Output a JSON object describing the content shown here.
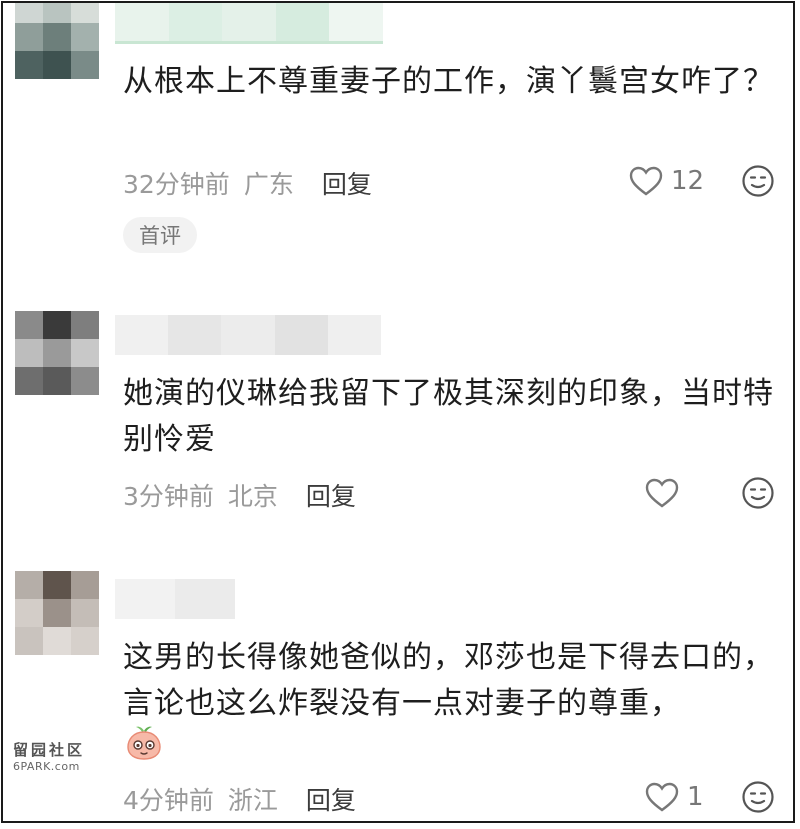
{
  "comments": [
    {
      "text": "从根本上不尊重妻子的工作，演丫鬟宫女咋了？",
      "time": "32分钟前",
      "location": "广东",
      "reply_label": "回复",
      "likes": "12",
      "badge": "首评"
    },
    {
      "text": "她演的仪琳给我留下了极其深刻的印象，当时特别怜爱",
      "time": "3分钟前",
      "location": "北京",
      "reply_label": "回复",
      "likes": ""
    },
    {
      "text": "这男的长得像她爸似的，邓莎也是下得去口的，言论也这么炸裂没有一点对妻子的尊重，",
      "time": "4分钟前",
      "location": "浙江",
      "reply_label": "回复",
      "likes": "1"
    }
  ],
  "icons": {
    "like": "heart-outline-icon",
    "react": "smiley-face-icon",
    "emoji": "peach-emoji-icon"
  },
  "watermark": {
    "line1": "留园社区",
    "line2": "6PARK.com"
  },
  "colors": {
    "meta_text": "#9a9a9a",
    "reply_text": "#3c3c3c",
    "body_text": "#1e1e1e",
    "badge_bg": "#f2f2f2",
    "border": "#1a1a1a"
  }
}
